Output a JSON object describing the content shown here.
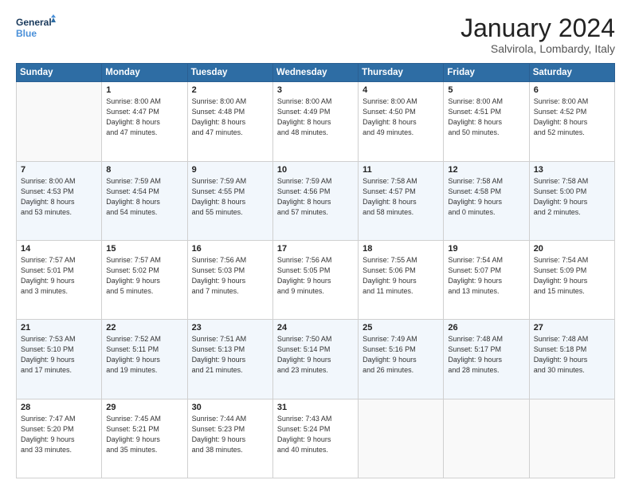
{
  "logo": {
    "line1": "General",
    "line2": "Blue"
  },
  "title": "January 2024",
  "location": "Salvirola, Lombardy, Italy",
  "days_header": [
    "Sunday",
    "Monday",
    "Tuesday",
    "Wednesday",
    "Thursday",
    "Friday",
    "Saturday"
  ],
  "weeks": [
    [
      {
        "day": "",
        "info": ""
      },
      {
        "day": "1",
        "info": "Sunrise: 8:00 AM\nSunset: 4:47 PM\nDaylight: 8 hours\nand 47 minutes."
      },
      {
        "day": "2",
        "info": "Sunrise: 8:00 AM\nSunset: 4:48 PM\nDaylight: 8 hours\nand 47 minutes."
      },
      {
        "day": "3",
        "info": "Sunrise: 8:00 AM\nSunset: 4:49 PM\nDaylight: 8 hours\nand 48 minutes."
      },
      {
        "day": "4",
        "info": "Sunrise: 8:00 AM\nSunset: 4:50 PM\nDaylight: 8 hours\nand 49 minutes."
      },
      {
        "day": "5",
        "info": "Sunrise: 8:00 AM\nSunset: 4:51 PM\nDaylight: 8 hours\nand 50 minutes."
      },
      {
        "day": "6",
        "info": "Sunrise: 8:00 AM\nSunset: 4:52 PM\nDaylight: 8 hours\nand 52 minutes."
      }
    ],
    [
      {
        "day": "7",
        "info": "Sunrise: 8:00 AM\nSunset: 4:53 PM\nDaylight: 8 hours\nand 53 minutes."
      },
      {
        "day": "8",
        "info": "Sunrise: 7:59 AM\nSunset: 4:54 PM\nDaylight: 8 hours\nand 54 minutes."
      },
      {
        "day": "9",
        "info": "Sunrise: 7:59 AM\nSunset: 4:55 PM\nDaylight: 8 hours\nand 55 minutes."
      },
      {
        "day": "10",
        "info": "Sunrise: 7:59 AM\nSunset: 4:56 PM\nDaylight: 8 hours\nand 57 minutes."
      },
      {
        "day": "11",
        "info": "Sunrise: 7:58 AM\nSunset: 4:57 PM\nDaylight: 8 hours\nand 58 minutes."
      },
      {
        "day": "12",
        "info": "Sunrise: 7:58 AM\nSunset: 4:58 PM\nDaylight: 9 hours\nand 0 minutes."
      },
      {
        "day": "13",
        "info": "Sunrise: 7:58 AM\nSunset: 5:00 PM\nDaylight: 9 hours\nand 2 minutes."
      }
    ],
    [
      {
        "day": "14",
        "info": "Sunrise: 7:57 AM\nSunset: 5:01 PM\nDaylight: 9 hours\nand 3 minutes."
      },
      {
        "day": "15",
        "info": "Sunrise: 7:57 AM\nSunset: 5:02 PM\nDaylight: 9 hours\nand 5 minutes."
      },
      {
        "day": "16",
        "info": "Sunrise: 7:56 AM\nSunset: 5:03 PM\nDaylight: 9 hours\nand 7 minutes."
      },
      {
        "day": "17",
        "info": "Sunrise: 7:56 AM\nSunset: 5:05 PM\nDaylight: 9 hours\nand 9 minutes."
      },
      {
        "day": "18",
        "info": "Sunrise: 7:55 AM\nSunset: 5:06 PM\nDaylight: 9 hours\nand 11 minutes."
      },
      {
        "day": "19",
        "info": "Sunrise: 7:54 AM\nSunset: 5:07 PM\nDaylight: 9 hours\nand 13 minutes."
      },
      {
        "day": "20",
        "info": "Sunrise: 7:54 AM\nSunset: 5:09 PM\nDaylight: 9 hours\nand 15 minutes."
      }
    ],
    [
      {
        "day": "21",
        "info": "Sunrise: 7:53 AM\nSunset: 5:10 PM\nDaylight: 9 hours\nand 17 minutes."
      },
      {
        "day": "22",
        "info": "Sunrise: 7:52 AM\nSunset: 5:11 PM\nDaylight: 9 hours\nand 19 minutes."
      },
      {
        "day": "23",
        "info": "Sunrise: 7:51 AM\nSunset: 5:13 PM\nDaylight: 9 hours\nand 21 minutes."
      },
      {
        "day": "24",
        "info": "Sunrise: 7:50 AM\nSunset: 5:14 PM\nDaylight: 9 hours\nand 23 minutes."
      },
      {
        "day": "25",
        "info": "Sunrise: 7:49 AM\nSunset: 5:16 PM\nDaylight: 9 hours\nand 26 minutes."
      },
      {
        "day": "26",
        "info": "Sunrise: 7:48 AM\nSunset: 5:17 PM\nDaylight: 9 hours\nand 28 minutes."
      },
      {
        "day": "27",
        "info": "Sunrise: 7:48 AM\nSunset: 5:18 PM\nDaylight: 9 hours\nand 30 minutes."
      }
    ],
    [
      {
        "day": "28",
        "info": "Sunrise: 7:47 AM\nSunset: 5:20 PM\nDaylight: 9 hours\nand 33 minutes."
      },
      {
        "day": "29",
        "info": "Sunrise: 7:45 AM\nSunset: 5:21 PM\nDaylight: 9 hours\nand 35 minutes."
      },
      {
        "day": "30",
        "info": "Sunrise: 7:44 AM\nSunset: 5:23 PM\nDaylight: 9 hours\nand 38 minutes."
      },
      {
        "day": "31",
        "info": "Sunrise: 7:43 AM\nSunset: 5:24 PM\nDaylight: 9 hours\nand 40 minutes."
      },
      {
        "day": "",
        "info": ""
      },
      {
        "day": "",
        "info": ""
      },
      {
        "day": "",
        "info": ""
      }
    ]
  ]
}
